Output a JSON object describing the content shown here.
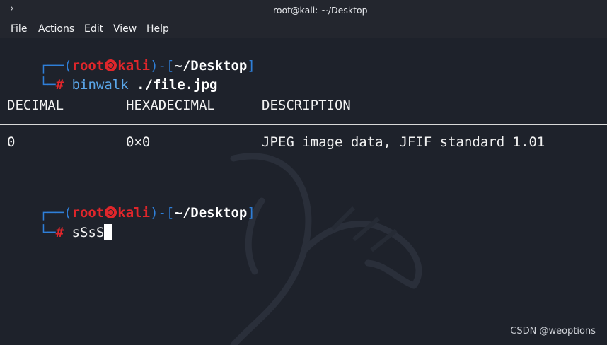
{
  "window": {
    "title": "root@kali: ~/Desktop"
  },
  "menu": [
    "File",
    "Actions",
    "Edit",
    "View",
    "Help"
  ],
  "prompt1": {
    "open": "┌──(",
    "user": "root",
    "host": "kali",
    "mid": ")-[",
    "path": "~/Desktop",
    "close": "]",
    "hash": "#",
    "command": "binwalk",
    "arg": "./file.jpg"
  },
  "output": {
    "headers": [
      "DECIMAL",
      "HEXADECIMAL",
      "DESCRIPTION"
    ],
    "rows": [
      {
        "decimal": "0",
        "hex": "0×0",
        "description": "JPEG image data, JFIF standard 1.01"
      }
    ]
  },
  "prompt2": {
    "open": "┌──(",
    "user": "root",
    "host": "kali",
    "mid": ")-[",
    "path": "~/Desktop",
    "close": "]",
    "hash": "#",
    "input": "sSsS"
  },
  "watermark": "CSDN @weoptions"
}
